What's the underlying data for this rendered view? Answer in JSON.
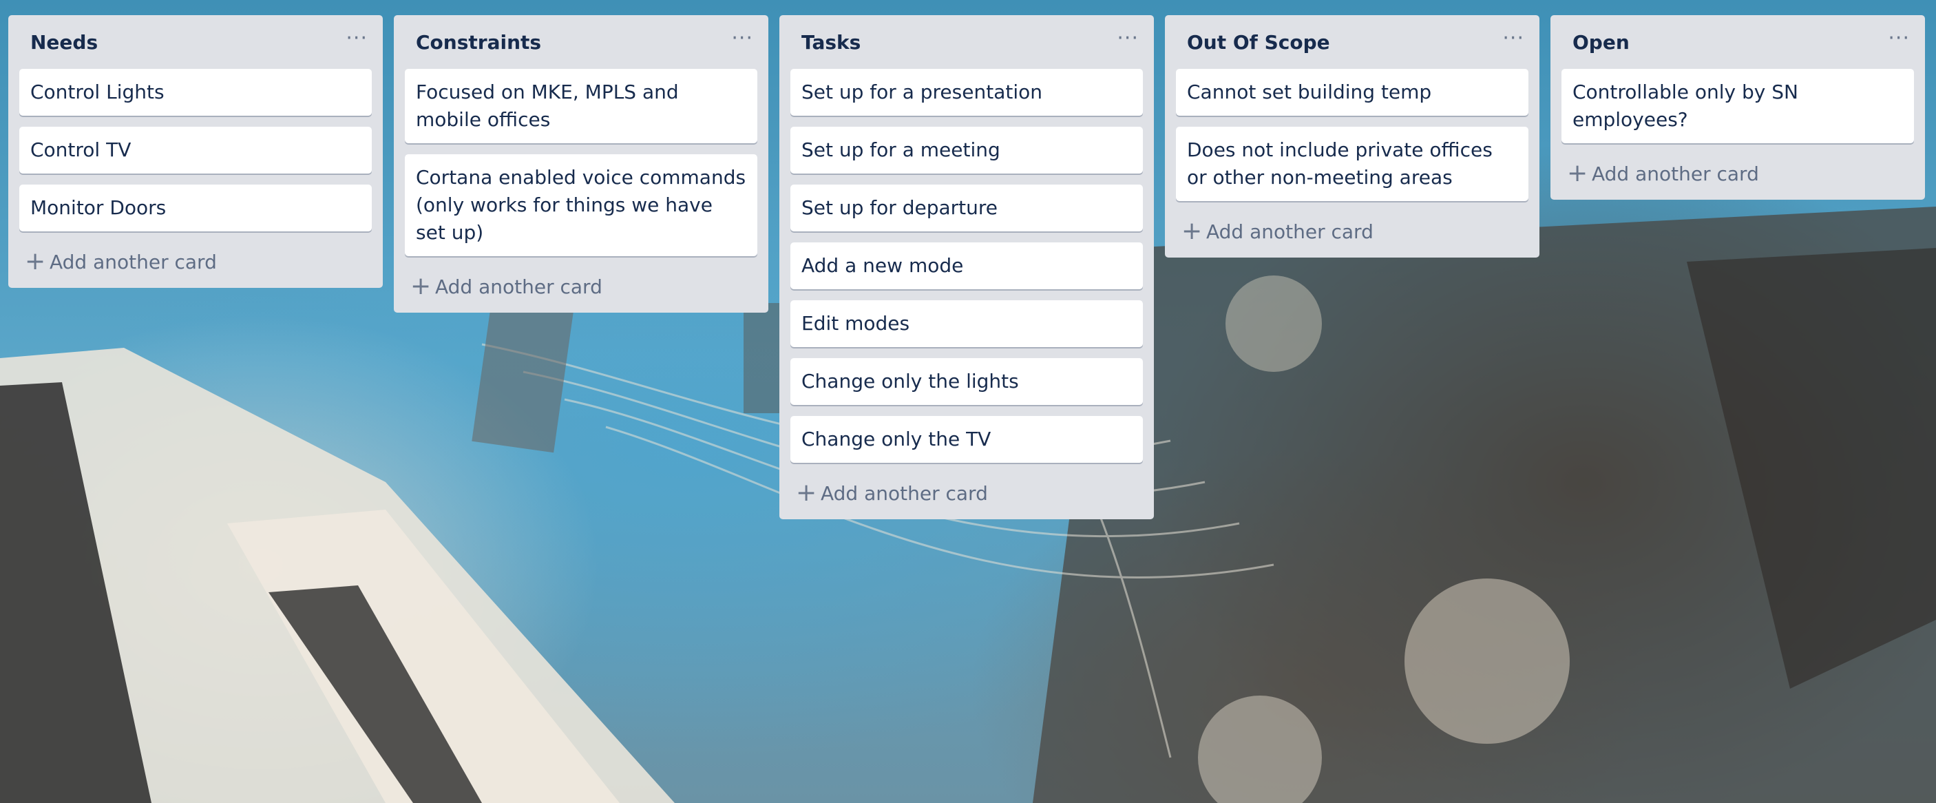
{
  "board": {
    "lists": [
      {
        "title": "Needs",
        "cards": [
          "Control Lights",
          "Control TV",
          "Monitor Doors"
        ],
        "add_label": "Add another card"
      },
      {
        "title": "Constraints",
        "cards": [
          "Focused on MKE, MPLS and mobile offices",
          "Cortana enabled voice commands (only works for things we have set up)"
        ],
        "add_label": "Add another card"
      },
      {
        "title": "Tasks",
        "cards": [
          "Set up for a presentation",
          "Set up for a meeting",
          "Set up for departure",
          "Add a new mode",
          "Edit modes",
          "Change only the lights",
          "Change only the TV"
        ],
        "add_label": "Add another card"
      },
      {
        "title": "Out Of Scope",
        "cards": [
          "Cannot set building temp",
          "Does not include private offices or other non-meeting areas"
        ],
        "add_label": "Add another card"
      },
      {
        "title": "Open",
        "cards": [
          "Controllable only by SN employees?"
        ],
        "add_label": "Add another card"
      }
    ],
    "icons": {
      "list_menu": "more-horizontal-icon",
      "add": "plus-icon"
    },
    "colors": {
      "list_bg": "#dfe1e6",
      "card_bg": "#ffffff",
      "title_text": "#172b4d",
      "muted_text": "#5e6c84"
    }
  }
}
